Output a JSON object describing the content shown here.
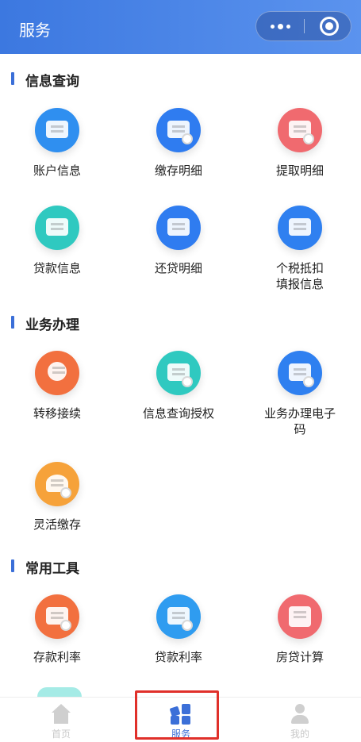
{
  "header": {
    "title": "服务"
  },
  "capsule": {
    "more_icon": "more-dots-icon",
    "close_icon": "record-circle-icon"
  },
  "sections": [
    {
      "title": "信息查询",
      "items": [
        {
          "label": "账户信息",
          "icon": "id-card-icon",
          "color": "#2f8ff0"
        },
        {
          "label": "缴存明细",
          "icon": "yuan-deposit-icon",
          "color": "#2f7cf0"
        },
        {
          "label": "提取明细",
          "icon": "yuan-withdraw-icon",
          "color": "#f06a6f"
        },
        {
          "label": "贷款信息",
          "icon": "loan-card-icon",
          "color": "#2fc9c0"
        },
        {
          "label": "还贷明细",
          "icon": "repay-icon",
          "color": "#2f7cf0"
        },
        {
          "label": "个税抵扣\n填报信息",
          "icon": "tax-icon",
          "color": "#2f80f0"
        }
      ]
    },
    {
      "title": "业务办理",
      "items": [
        {
          "label": "转移接续",
          "icon": "transfer-icon",
          "color": "#f2703f"
        },
        {
          "label": "信息查询授权",
          "icon": "authorize-icon",
          "color": "#2fc9c0"
        },
        {
          "label": "业务办理电子\n码",
          "icon": "ecode-icon",
          "color": "#2f80f0"
        },
        {
          "label": "灵活缴存",
          "icon": "flexible-deposit-icon",
          "color": "#f6a23a"
        }
      ]
    },
    {
      "title": "常用工具",
      "items": [
        {
          "label": "存款利率",
          "icon": "deposit-rate-icon",
          "color": "#f2703f"
        },
        {
          "label": "贷款利率",
          "icon": "loan-rate-icon",
          "color": "#2f9cf0"
        },
        {
          "label": "房贷计算",
          "icon": "calculator-icon",
          "color": "#f06a6f"
        }
      ]
    }
  ],
  "tabbar": {
    "home": {
      "label": "首页",
      "icon": "home-icon"
    },
    "service": {
      "label": "服务",
      "icon": "service-grid-icon"
    },
    "mine": {
      "label": "我的",
      "icon": "user-icon"
    }
  },
  "colors": {
    "header": "#3c78e0",
    "accent": "#3b6fd8",
    "highlight": "#e0302a"
  }
}
